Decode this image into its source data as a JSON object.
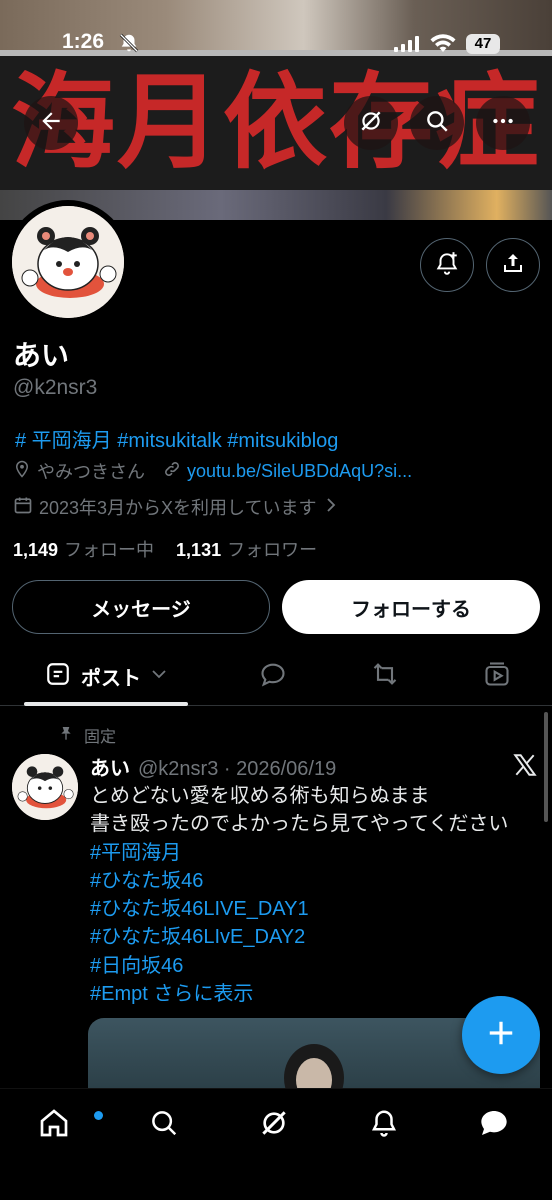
{
  "status_bar": {
    "time": "1:26",
    "battery": "47"
  },
  "banner": {
    "text": "海月依存症"
  },
  "profile": {
    "display_name": "あい",
    "handle": "@k2nsr3",
    "bio": "# 平岡海月 #mitsukitalk #mitsukiblog",
    "location": "やみつきさん",
    "link": "youtu.be/SileUBDdAqU?si...",
    "joined": "2023年3月からXを利用しています",
    "following_count": "1,149",
    "following_label": "フォロー中",
    "followers_count": "1,131",
    "followers_label": "フォロワー"
  },
  "actions": {
    "message_label": "メッセージ",
    "follow_label": "フォローする"
  },
  "tabs": {
    "posts_label": "ポスト"
  },
  "pinned_post": {
    "pinned_label": "固定",
    "name": "あい",
    "handle_date": "@k2nsr3 · 2026/06/19",
    "line1": "とめどない愛を収める術も知らぬまま",
    "line2": "書き殴ったのでよかったら見てやってください",
    "tags": [
      "#平岡海月",
      "#ひなた坂46",
      "#ひなた坂46LIVE_DAY1",
      "#ひなた坂46LIvE_DAY2",
      "#日向坂46"
    ],
    "last_tag": "#Empt",
    "show_more": "さらに表示"
  },
  "icons": {
    "back": "arrow-left-icon",
    "grok": "grok-icon",
    "search": "search-icon",
    "more": "more-icon",
    "notify": "bell-plus-icon",
    "share": "share-icon",
    "home": "home-icon",
    "notifications": "bell-icon",
    "messages": "message-icon"
  },
  "colors": {
    "accent": "#1d9bf0",
    "background": "#000000",
    "muted": "#71767b",
    "banner_text": "#c62828"
  }
}
